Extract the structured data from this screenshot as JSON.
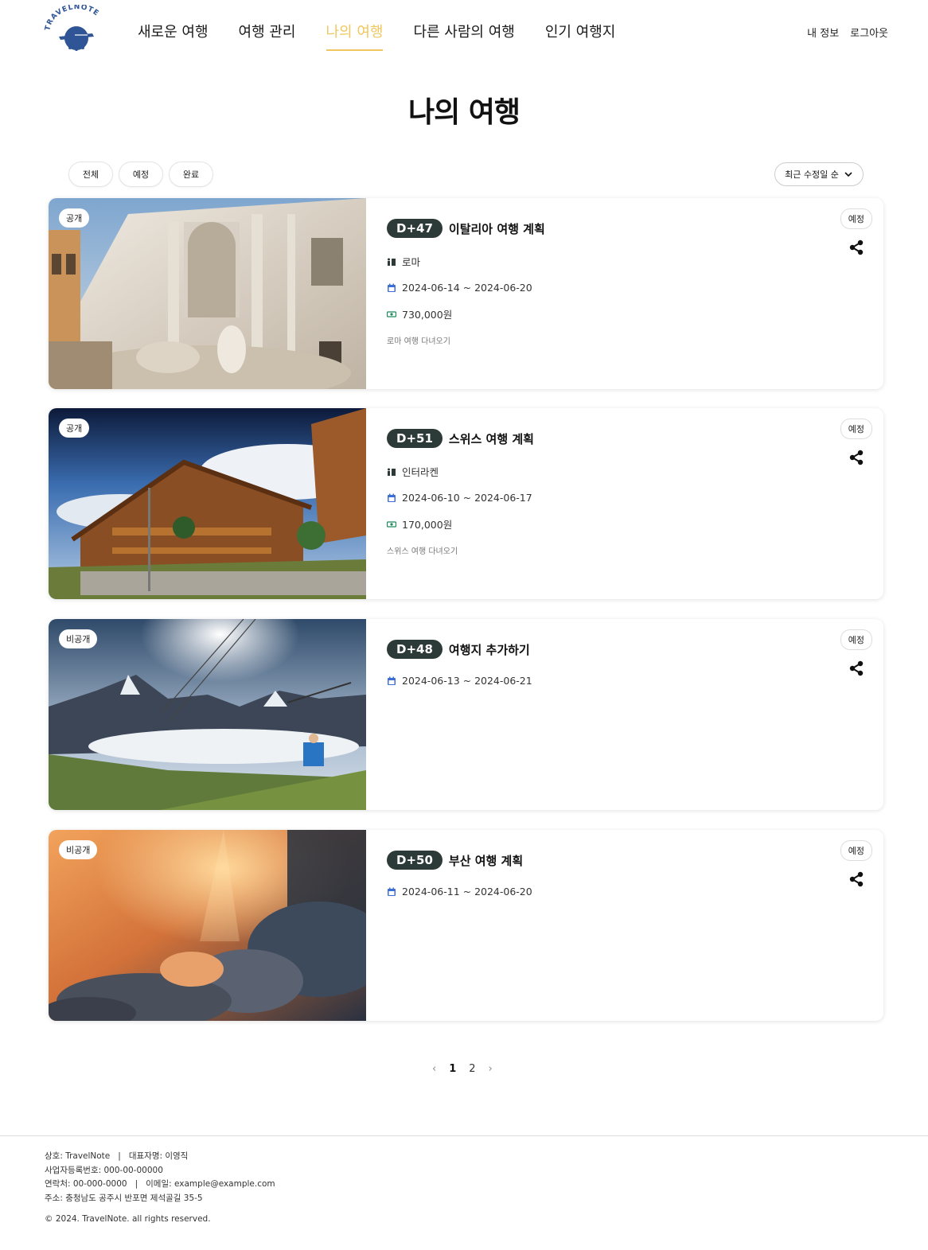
{
  "brand": {
    "logo_text": "TRAVELNOTE",
    "accent": "#f0c75e",
    "logo_color": "#2f5597"
  },
  "nav": [
    {
      "label": "새로운 여행",
      "active": false
    },
    {
      "label": "여행 관리",
      "active": false
    },
    {
      "label": "나의 여행",
      "active": true
    },
    {
      "label": "다른 사람의 여행",
      "active": false
    },
    {
      "label": "인기 여행지",
      "active": false
    }
  ],
  "user": {
    "profile": "내 정보",
    "logout": "로그아웃"
  },
  "page_title": "나의 여행",
  "filters": [
    "전체",
    "예정",
    "완료"
  ],
  "sort": {
    "label": "최근 수정일 순"
  },
  "trips": [
    {
      "visibility": "공개",
      "dday": "D+47",
      "title": "이탈리아 여행 계획",
      "location": "로마",
      "dates": "2024-06-14 ~ 2024-06-20",
      "budget": "730,000원",
      "memo": "로마 여행 다녀오기",
      "status": "예정",
      "image": "trevi-fountain"
    },
    {
      "visibility": "공개",
      "dday": "D+51",
      "title": "스위스 여행 계획",
      "location": "인터라켄",
      "dates": "2024-06-10 ~ 2024-06-17",
      "budget": "170,000원",
      "memo": "스위스 여행 다녀오기",
      "status": "예정",
      "image": "swiss-chalet"
    },
    {
      "visibility": "비공개",
      "dday": "D+48",
      "title": "여행지 추가하기",
      "dates": "2024-06-13 ~ 2024-06-21",
      "status": "예정",
      "image": "zipline-mountains"
    },
    {
      "visibility": "비공개",
      "dday": "D+50",
      "title": "부산 여행 계획",
      "dates": "2024-06-11 ~ 2024-06-20",
      "status": "예정",
      "image": "sunset-clouds"
    }
  ],
  "pagination": {
    "prev": "‹",
    "pages": [
      "1",
      "2"
    ],
    "next": "›",
    "current": "1"
  },
  "footer": {
    "company": "상호: TravelNote",
    "separator": "|",
    "ceo": "대표자명: 이영직",
    "business_no": "사업자등록번호: 000-00-00000",
    "phone": "연락처: 00-000-0000",
    "email": "이메일: example@example.com",
    "address": "주소: 충청남도 공주시 반포면 제석골길 35-5",
    "copyright": "© 2024. TravelNote. all rights reserved."
  },
  "icons": {
    "location": "map-pin-icon",
    "calendar": "calendar-icon",
    "budget": "money-icon",
    "share": "share-icon",
    "sort": "chevron-down-icon"
  }
}
